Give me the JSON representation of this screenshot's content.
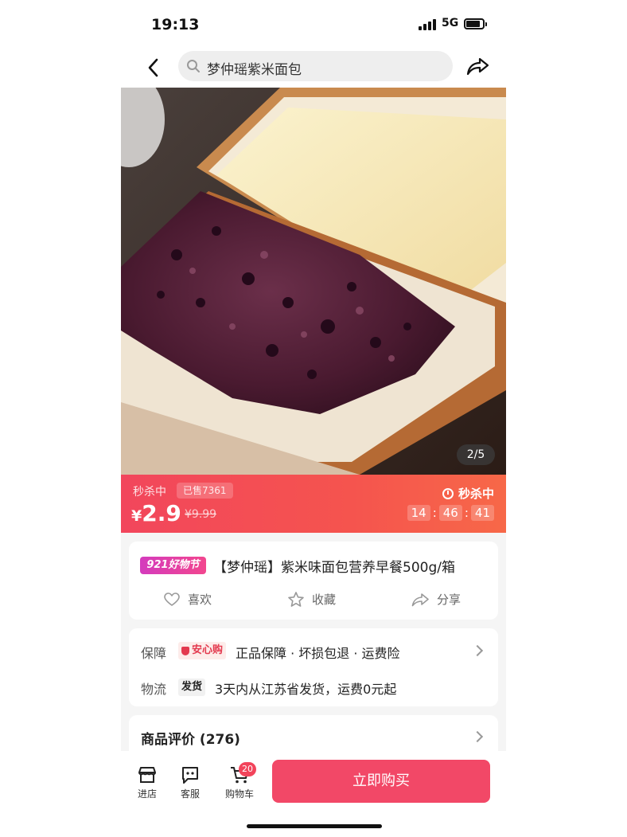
{
  "status": {
    "time": "19:13",
    "network": "5G"
  },
  "nav": {
    "search_text": "梦仲瑶紫米面包"
  },
  "hero": {
    "pager": "2/5"
  },
  "flash": {
    "tag": "秒杀中",
    "sold": "已售7361",
    "currency": "¥",
    "price": "2.9",
    "original_price": "¥9.99",
    "label": "秒杀中",
    "countdown": {
      "h": "14",
      "m": "46",
      "s": "41",
      "sep": ":"
    }
  },
  "product": {
    "badge": "921好物节",
    "title": "【梦仲瑶】紫米味面包营养早餐500g/箱",
    "actions": {
      "like": "喜欢",
      "collect": "收藏",
      "share": "分享"
    }
  },
  "info": {
    "guarantee_label": "保障",
    "guarantee_badge": "安心购",
    "guarantee_text": "正品保障 · 坏损包退 · 运费险",
    "logistics_label": "物流",
    "logistics_badge": "发货",
    "logistics_text": "3天内从江苏省发货，运费0元起"
  },
  "review": {
    "title": "商品评价 (276)"
  },
  "bottom": {
    "store": "进店",
    "service": "客服",
    "cart": "购物车",
    "cart_count": "20",
    "buy": "立即购买"
  },
  "colors": {
    "accent": "#f24867",
    "flash_bg": "#f2465c"
  }
}
